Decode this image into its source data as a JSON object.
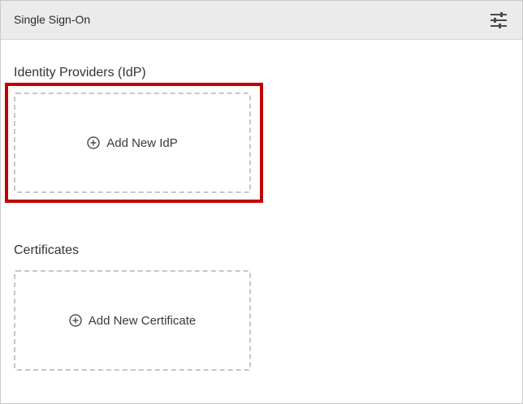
{
  "header": {
    "title": "Single Sign-On",
    "settings_icon": "sliders-icon"
  },
  "identity_providers": {
    "title": "Identity Providers (IdP)",
    "add_label": "Add New IdP",
    "add_icon": "plus-circle-icon"
  },
  "certificates": {
    "title": "Certificates",
    "add_label": "Add New Certificate",
    "add_icon": "plus-circle-icon"
  },
  "colors": {
    "highlight": "#c00000",
    "header_bg": "#ebebeb",
    "dashed_border": "#c6c6c6"
  }
}
